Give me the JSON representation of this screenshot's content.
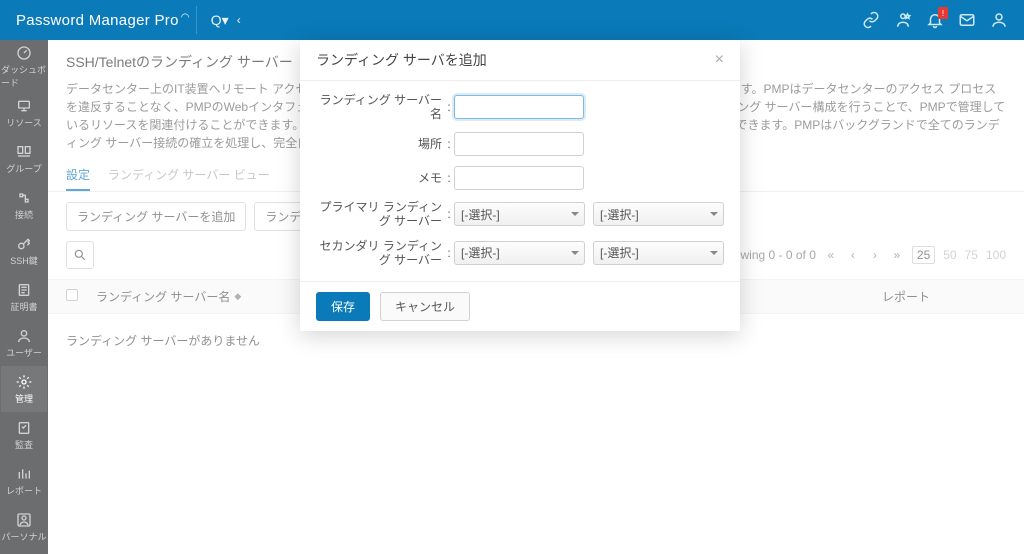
{
  "app": {
    "title": "Password Manager Pro"
  },
  "sidebar": {
    "items": [
      {
        "label": "ダッシュボード"
      },
      {
        "label": "リソース"
      },
      {
        "label": "グループ"
      },
      {
        "label": "接続"
      },
      {
        "label": "SSH鍵"
      },
      {
        "label": "証明書"
      },
      {
        "label": "ユーザー"
      },
      {
        "label": "管理"
      },
      {
        "label": "監査"
      },
      {
        "label": "レポート"
      },
      {
        "label": "パーソナル"
      }
    ]
  },
  "page": {
    "title": "SSH/Telnetのランディング サーバー",
    "description": "データセンター上のIT装置へリモート アクセスする場合、セキュリティ対策を施したランディング サーバーを経由して行います。PMPはデータセンターのアクセス プロセスを違反することなく、PMPのWebインタフェースからワンクリックで直接、安全な接続を確立できるようにします。ランディング サーバー構成を行うことで、PMPで管理しているリソースを関連付けることができます。設定が完了すると、中継を気にすることなくワンクリックでリモート接続を確立できます。PMPはバックグランドで全てのランディング サーバー接続の確立を処理し、完全自動でリモートのリソースへの接続を可能にします"
  },
  "tabs": {
    "items": [
      {
        "label": "設定",
        "active": true
      },
      {
        "label": "ランディング サーバー ビュー",
        "active": false
      }
    ]
  },
  "toolbar": {
    "add_label": "ランディング サーバーを追加",
    "view_label": "ランディング サーバー ビュー"
  },
  "pagination": {
    "showing_text": "howing 0 - 0 of 0",
    "sizes": [
      "25",
      "50",
      "75",
      "100"
    ],
    "selected_size": "25"
  },
  "table": {
    "columns": {
      "name": "ランディング サーバー名",
      "report": "レポート"
    },
    "empty_text": "ランディング サーバーがありません"
  },
  "modal": {
    "title": "ランディング サーバを追加",
    "fields": {
      "server_name": "ランディング サーバー名",
      "location": "場所",
      "memo": "メモ",
      "primary": "プライマリ ランディング サーバー",
      "secondary": "セカンダリ ランディング サーバー"
    },
    "select_placeholder": "[-選択-]",
    "save": "保存",
    "cancel": "キャンセル"
  },
  "bell_badge": "!"
}
